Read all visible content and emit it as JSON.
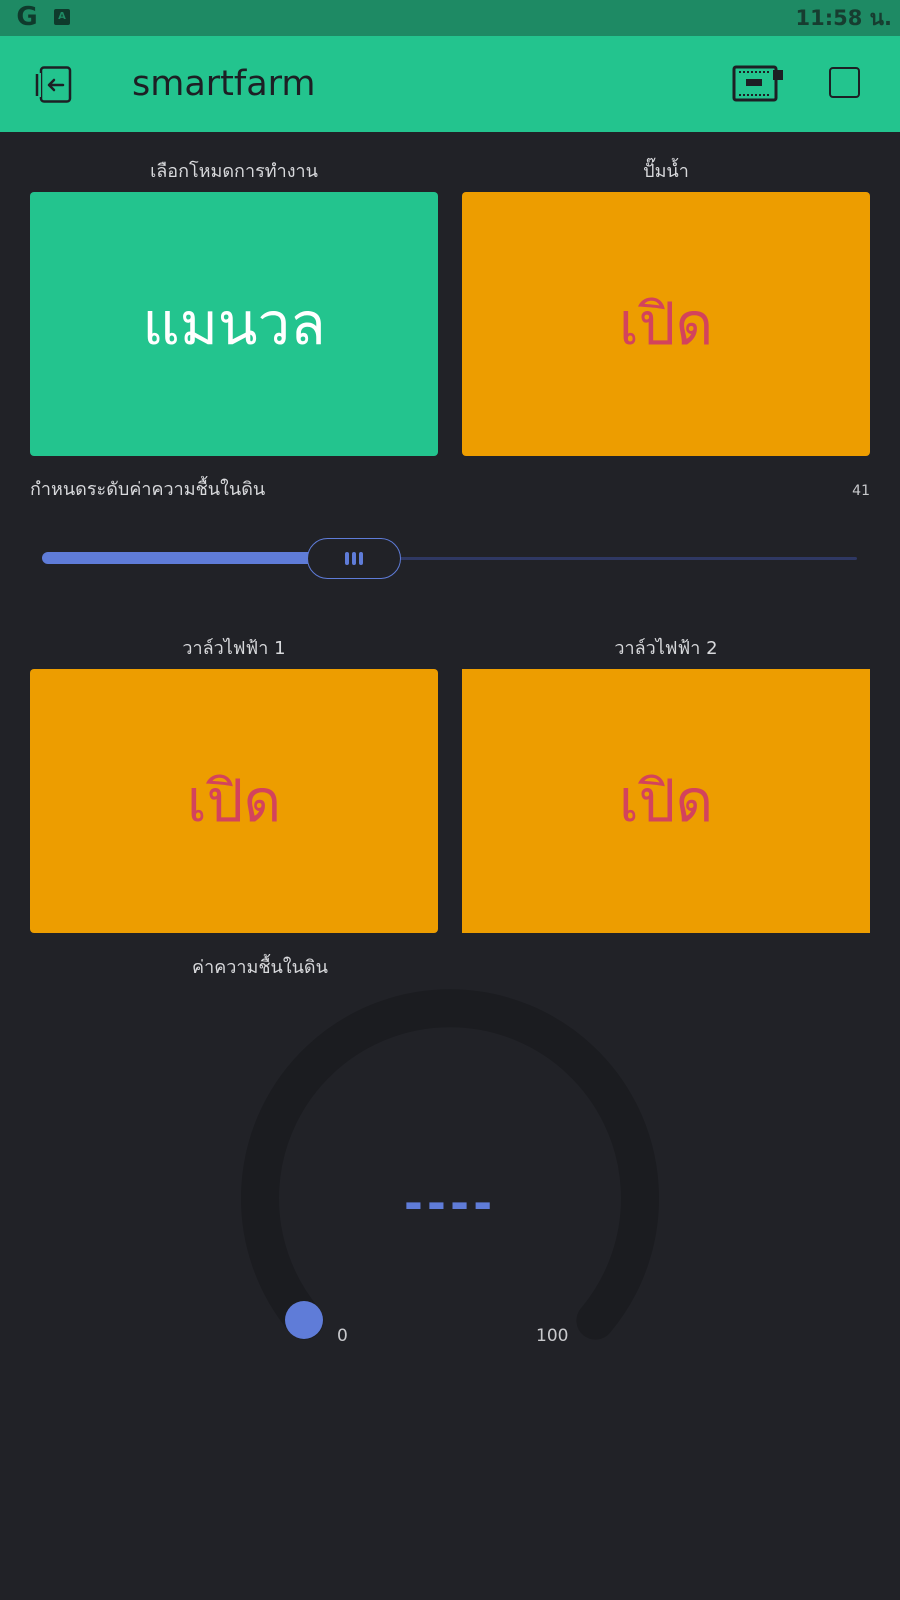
{
  "status_bar": {
    "time": "11:58 น.",
    "icons": [
      "google-icon",
      "keyboard-icon"
    ]
  },
  "app_bar": {
    "title": "smartfarm",
    "icons": [
      "exit-icon",
      "device-icon",
      "square-icon"
    ]
  },
  "widgets": {
    "mode": {
      "label": "เลือกโหมดการทำงาน",
      "value": "แมนวล"
    },
    "pump": {
      "label": "ปั๊มน้ำ",
      "value": "เปิด"
    },
    "slider": {
      "label": "กำหนดระดับค่าความชื้นในดิน",
      "value": "41",
      "level": 41,
      "min": 0,
      "max": 100
    },
    "valve1": {
      "label": "วาล์วไฟฟ้า 1",
      "value": "เปิด"
    },
    "valve2": {
      "label": "วาล์วไฟฟ้า 2",
      "value": "เปิด"
    },
    "gauge": {
      "label": "ค่าความชื้นในดิน",
      "value": "----",
      "min": "0",
      "max": "100"
    }
  },
  "colors": {
    "accent_green": "#23c48e",
    "accent_orange": "#ed9d00",
    "button_text_red": "#d3435c",
    "slider_blue": "#5f7cd8",
    "background": "#212227"
  }
}
